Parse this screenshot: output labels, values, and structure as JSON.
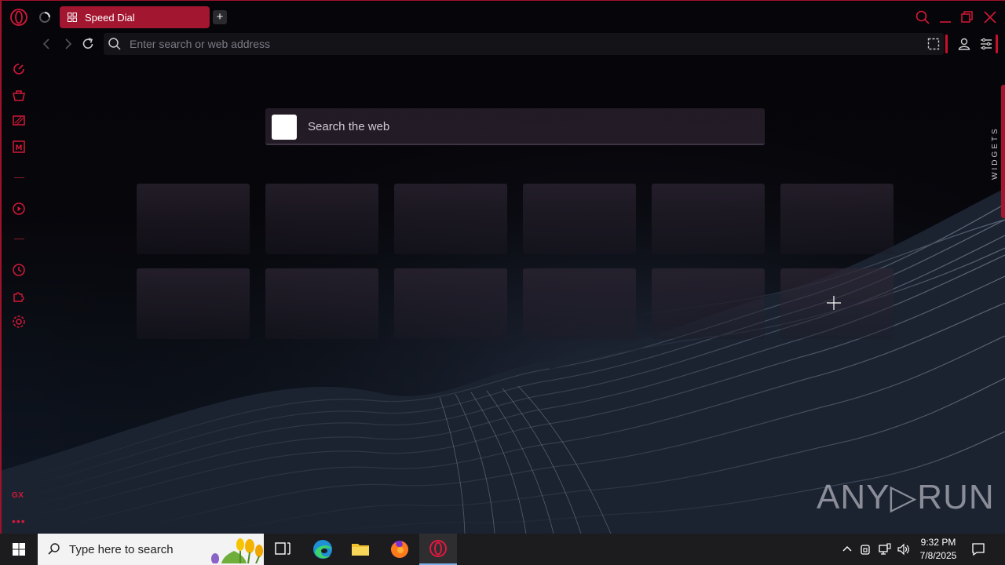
{
  "tab": {
    "title": "Speed Dial"
  },
  "address_bar": {
    "placeholder": "Enter search or web address"
  },
  "speed_dial": {
    "search_placeholder": "Search the web",
    "tiles_count": 12
  },
  "widgets_label": "WIDGETS",
  "sidebar": {
    "items": [
      "speed-dial",
      "shopping-corner",
      "twitch",
      "gx-mail",
      "player",
      "history",
      "extensions",
      "settings"
    ],
    "gx_label": "GX",
    "more": "•••"
  },
  "watermark": "ANY▷RUN",
  "taskbar": {
    "search_placeholder": "Type here to search",
    "time": "9:32 PM",
    "date": "7/8/2025"
  },
  "colors": {
    "accent": "#c8102e",
    "tab": "#a31630"
  }
}
